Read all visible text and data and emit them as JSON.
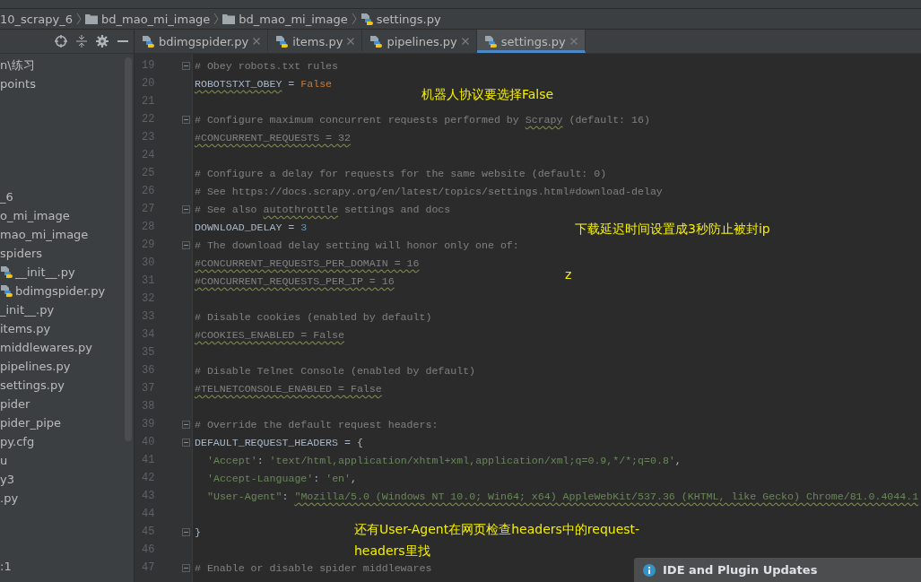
{
  "breadcrumb": [
    {
      "label": "10_scrapy_6",
      "kind": "project"
    },
    {
      "label": "bd_mao_mi_image",
      "kind": "folder"
    },
    {
      "label": "bd_mao_mi_image",
      "kind": "folder"
    },
    {
      "label": "settings.py",
      "kind": "python"
    }
  ],
  "tabs": [
    {
      "label": "bdimgspider.py",
      "selected": false
    },
    {
      "label": "items.py",
      "selected": false
    },
    {
      "label": "pipelines.py",
      "selected": false
    },
    {
      "label": "settings.py",
      "selected": true
    }
  ],
  "project_tree": {
    "top": [
      {
        "label": "n\\练习",
        "kind": "text"
      },
      {
        "label": "points",
        "kind": "text"
      }
    ],
    "middle": [
      {
        "label": "_6",
        "kind": "text"
      },
      {
        "label": "o_mi_image",
        "kind": "text"
      },
      {
        "label": "mao_mi_image",
        "kind": "text"
      },
      {
        "label": "spiders",
        "kind": "text"
      },
      {
        "label": "__init__.py",
        "kind": "python"
      },
      {
        "label": "bdimgspider.py",
        "kind": "python"
      },
      {
        "label": "_init__.py",
        "kind": "text"
      },
      {
        "label": "items.py",
        "kind": "text"
      },
      {
        "label": "middlewares.py",
        "kind": "text"
      },
      {
        "label": "pipelines.py",
        "kind": "text"
      },
      {
        "label": "settings.py",
        "kind": "text"
      },
      {
        "label": "pider",
        "kind": "text"
      },
      {
        "label": "pider_pipe",
        "kind": "text"
      },
      {
        "label": "py.cfg",
        "kind": "text"
      },
      {
        "label": "u",
        "kind": "text"
      },
      {
        "label": "y3",
        "kind": "text"
      },
      {
        "label": ".py",
        "kind": "text"
      }
    ],
    "bottom": ":1"
  },
  "editor_lines": [
    {
      "number": "19",
      "fold": true,
      "segments": [
        {
          "kind": "comment",
          "text": "# Obey robots.txt rules"
        }
      ]
    },
    {
      "number": "20",
      "segments": [
        {
          "kind": "name",
          "text": "ROBOTSTXT_OBEY",
          "warn": true
        },
        {
          "kind": "op",
          "text": " = "
        },
        {
          "kind": "keyword",
          "text": "False"
        }
      ]
    },
    {
      "number": "21"
    },
    {
      "number": "22",
      "fold": true,
      "segments": [
        {
          "kind": "comment",
          "text": "# Configure maximum concurrent requests performed by "
        },
        {
          "kind": "comment",
          "text": "Scrapy",
          "warn": true
        },
        {
          "kind": "comment",
          "text": " (default: 16)"
        }
      ]
    },
    {
      "number": "23",
      "segments": [
        {
          "kind": "comment",
          "text": "#CONCURRENT_REQUESTS = 32",
          "warn": true
        }
      ]
    },
    {
      "number": "24"
    },
    {
      "number": "25",
      "segments": [
        {
          "kind": "comment",
          "text": "# Configure a delay for requests for the same website (default: 0)"
        }
      ]
    },
    {
      "number": "26",
      "segments": [
        {
          "kind": "comment",
          "text": "# See https://docs.scrapy.org/en/latest/topics/settings.html#download-delay"
        }
      ]
    },
    {
      "number": "27",
      "fold": true,
      "segments": [
        {
          "kind": "comment",
          "text": "# See also "
        },
        {
          "kind": "comment",
          "text": "autothrottle",
          "warn": true
        },
        {
          "kind": "comment",
          "text": " settings and docs"
        }
      ]
    },
    {
      "number": "28",
      "segments": [
        {
          "kind": "name",
          "text": "DOWNLOAD_DELAY"
        },
        {
          "kind": "op",
          "text": " = "
        },
        {
          "kind": "number",
          "text": "3"
        }
      ]
    },
    {
      "number": "29",
      "fold": true,
      "segments": [
        {
          "kind": "comment",
          "text": "# The download delay setting will honor only one of:"
        }
      ]
    },
    {
      "number": "30",
      "segments": [
        {
          "kind": "comment",
          "text": "#CONCURRENT_REQUESTS_PER_DOMAIN = 16",
          "warn": true
        }
      ]
    },
    {
      "number": "31",
      "segments": [
        {
          "kind": "comment",
          "text": "#CONCURRENT_REQUESTS_PER_IP = 16",
          "warn": true
        }
      ]
    },
    {
      "number": "32"
    },
    {
      "number": "33",
      "segments": [
        {
          "kind": "comment",
          "text": "# Disable cookies (enabled by default)"
        }
      ]
    },
    {
      "number": "34",
      "segments": [
        {
          "kind": "comment",
          "text": "#COOKIES_ENABLED = False",
          "warn": true
        }
      ]
    },
    {
      "number": "35"
    },
    {
      "number": "36",
      "segments": [
        {
          "kind": "comment",
          "text": "# Disable Telnet Console (enabled by default)"
        }
      ]
    },
    {
      "number": "37",
      "segments": [
        {
          "kind": "comment",
          "text": "#TELNETCONSOLE_ENABLED = False",
          "warn": true
        }
      ]
    },
    {
      "number": "38"
    },
    {
      "number": "39",
      "fold": true,
      "segments": [
        {
          "kind": "comment",
          "text": "# Override the default request headers:"
        }
      ]
    },
    {
      "number": "40",
      "fold": true,
      "segments": [
        {
          "kind": "name",
          "text": "DEFAULT_REQUEST_HEADERS = {"
        }
      ]
    },
    {
      "number": "41",
      "indented": true,
      "segments": [
        {
          "kind": "string",
          "text": "'Accept'"
        },
        {
          "kind": "op",
          "text": ": "
        },
        {
          "kind": "string",
          "text": "'text/html,application/xhtml+xml,application/xml;q=0.9,*/*;q=0.8'"
        },
        {
          "kind": "op",
          "text": ","
        }
      ]
    },
    {
      "number": "42",
      "indented": true,
      "segments": [
        {
          "kind": "string",
          "text": "'Accept-Language'"
        },
        {
          "kind": "op",
          "text": ": "
        },
        {
          "kind": "string",
          "text": "'en'"
        },
        {
          "kind": "op",
          "text": ","
        }
      ]
    },
    {
      "number": "43",
      "indented": true,
      "segments": [
        {
          "kind": "string",
          "text": "\"User-Agent\""
        },
        {
          "kind": "op",
          "text": ": "
        },
        {
          "kind": "string",
          "text": "\"Mozilla/5.0 (Windows NT 10.0; Win64; x64) AppleWebKit/537.36 (KHTML, like Gecko) Chrome/81.0.4044.1",
          "warn": true
        }
      ]
    },
    {
      "number": "44"
    },
    {
      "number": "45",
      "fold": true,
      "segments": [
        {
          "kind": "name",
          "text": "}"
        }
      ]
    },
    {
      "number": "46"
    },
    {
      "number": "47",
      "fold": true,
      "segments": [
        {
          "kind": "comment",
          "text": "# Enable or disable spider middlewares"
        }
      ]
    }
  ],
  "annotations": [
    {
      "text": "机器人协议要选择False",
      "kind": "note-a"
    },
    {
      "text": "下载延迟时间设置成3秒防止被封ip",
      "kind": "note-b"
    },
    {
      "text": "z",
      "kind": "note-c"
    },
    {
      "text": "还有User-Agent在网页检查headers中的request-headers里找",
      "kind": "note-d"
    }
  ],
  "notification": {
    "title": "IDE and Plugin Updates"
  }
}
